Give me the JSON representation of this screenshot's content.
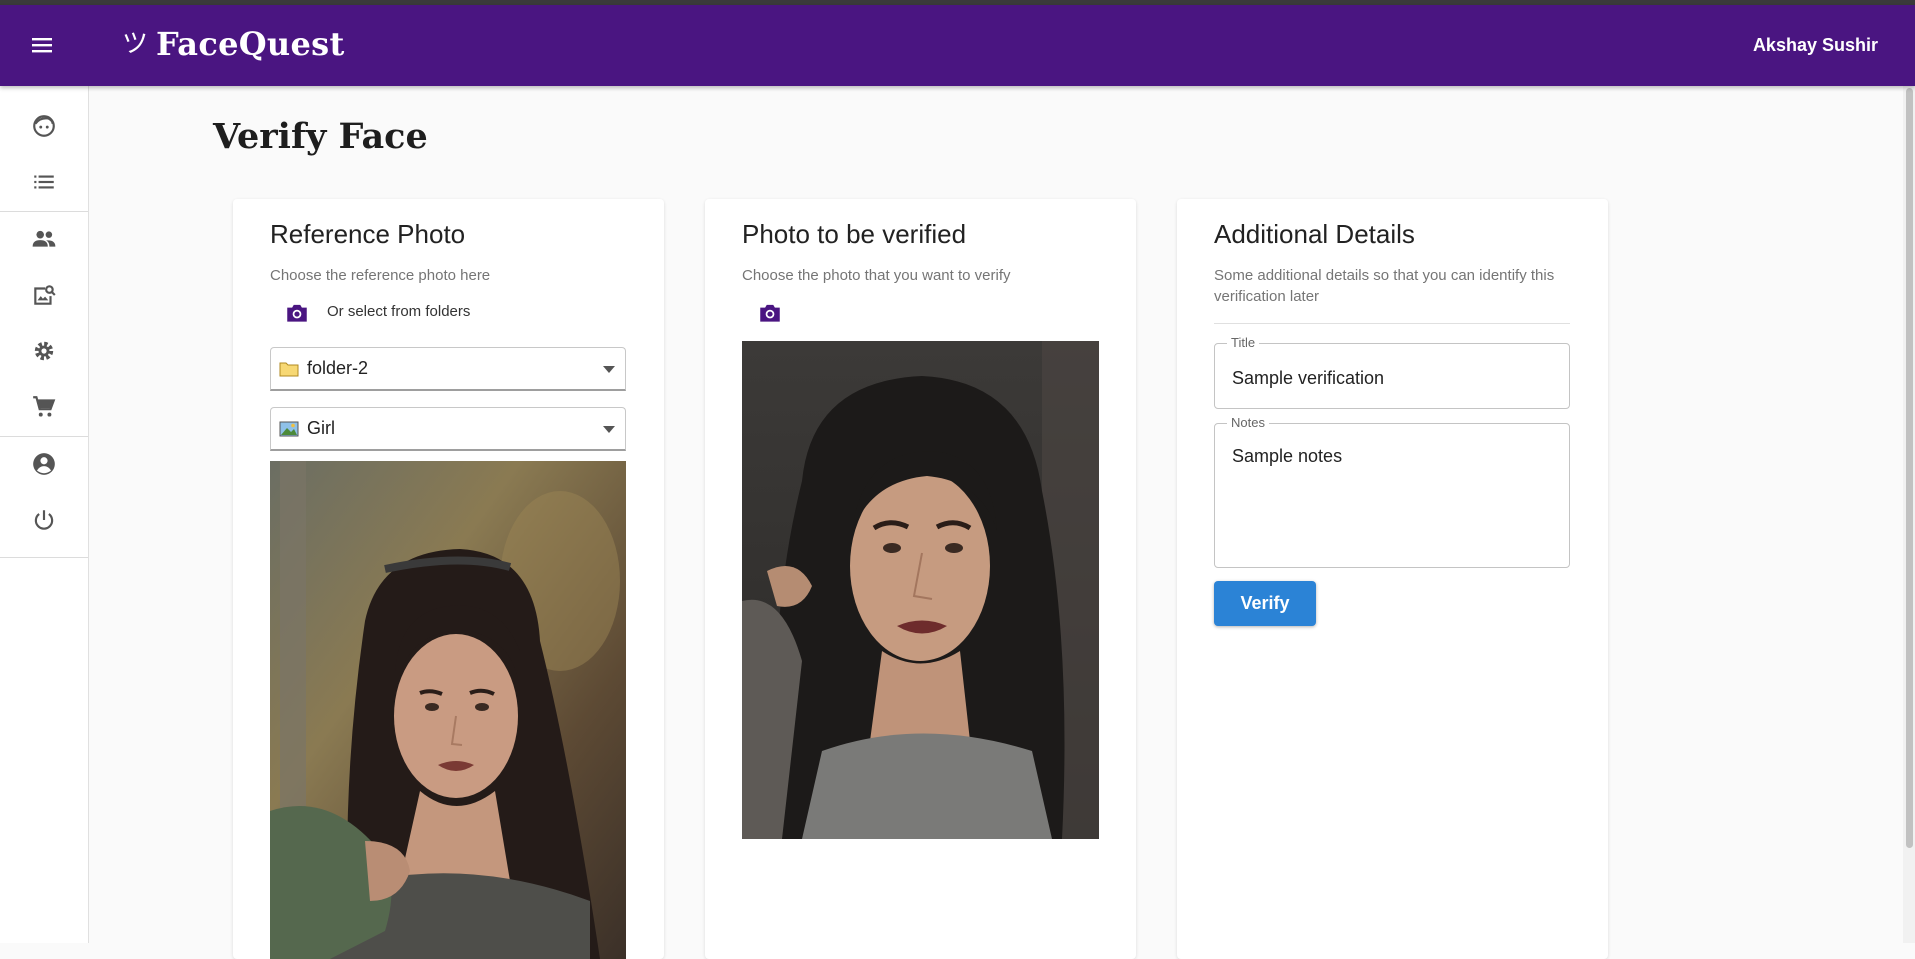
{
  "colors": {
    "brand": "#4a1581",
    "accent": "#2b83d6",
    "icon": "#4a1581",
    "nav_icon": "#555555"
  },
  "app": {
    "name": "FaceQuest",
    "logo_mark": "ツ",
    "user_name": "Akshay Sushir"
  },
  "sidebar": {
    "items": [
      {
        "icon": "face-icon"
      },
      {
        "icon": "list-icon"
      },
      {
        "icon": "people-icon"
      },
      {
        "icon": "image-search-icon"
      },
      {
        "icon": "settings-icon"
      },
      {
        "icon": "cart-icon"
      },
      {
        "icon": "account-icon"
      },
      {
        "icon": "power-icon"
      }
    ]
  },
  "page": {
    "title": "Verify Face"
  },
  "reference": {
    "title": "Reference Photo",
    "subtitle": "Choose the reference photo here",
    "folder_link": "Or select from folders",
    "folder_select": "folder-2",
    "image_select": "Girl"
  },
  "verify_photo": {
    "title": "Photo to be verified",
    "subtitle": "Choose the photo that you want to verify"
  },
  "details": {
    "title": "Additional Details",
    "subtitle": "Some additional details so that you can identify this verification later",
    "title_label": "Title",
    "title_value": "Sample verification",
    "notes_label": "Notes",
    "notes_value": "Sample notes",
    "verify_label": "Verify"
  }
}
